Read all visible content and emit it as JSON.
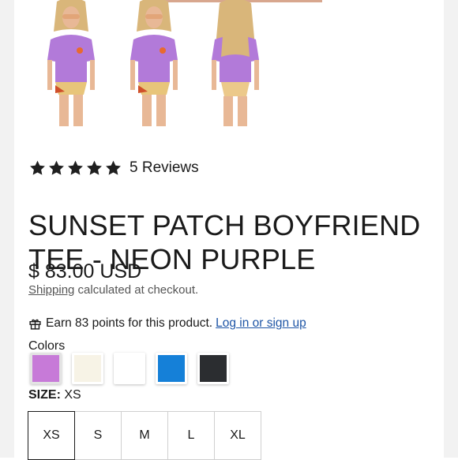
{
  "gallery": {
    "images": [
      {
        "alt": "model-front-view"
      },
      {
        "alt": "model-front-view-2"
      },
      {
        "alt": "model-back-view"
      }
    ]
  },
  "product": {
    "rating_stars": 5,
    "reviews_label": "5 Reviews",
    "title": "SUNSET PATCH BOYFRIEND TEE - NEON PURPLE",
    "price": "$ 83.00 USD",
    "shipping_link": "Shipping",
    "shipping_text": " calculated at checkout.",
    "points_text": "Earn 83 points for this product.",
    "points_link": "Log in or sign up",
    "colors_label": "Colors",
    "colors": [
      {
        "name": "neon-purple",
        "hex": "#c77ad8",
        "selected": true
      },
      {
        "name": "cream",
        "hex": "#f7f3e6",
        "selected": false
      },
      {
        "name": "white",
        "hex": "#ffffff",
        "selected": false
      },
      {
        "name": "blue",
        "hex": "#1580d8",
        "selected": false
      },
      {
        "name": "charcoal",
        "hex": "#2b2d30",
        "selected": false
      }
    ],
    "size_label": "SIZE:",
    "size_value": "XS",
    "sizes": [
      "XS",
      "S",
      "M",
      "L",
      "XL"
    ],
    "selected_size": "XS"
  },
  "theme": {
    "star_color": "#1f1f1f",
    "link_color": "#1e55a6",
    "shirt_color": "#b27ad9"
  }
}
